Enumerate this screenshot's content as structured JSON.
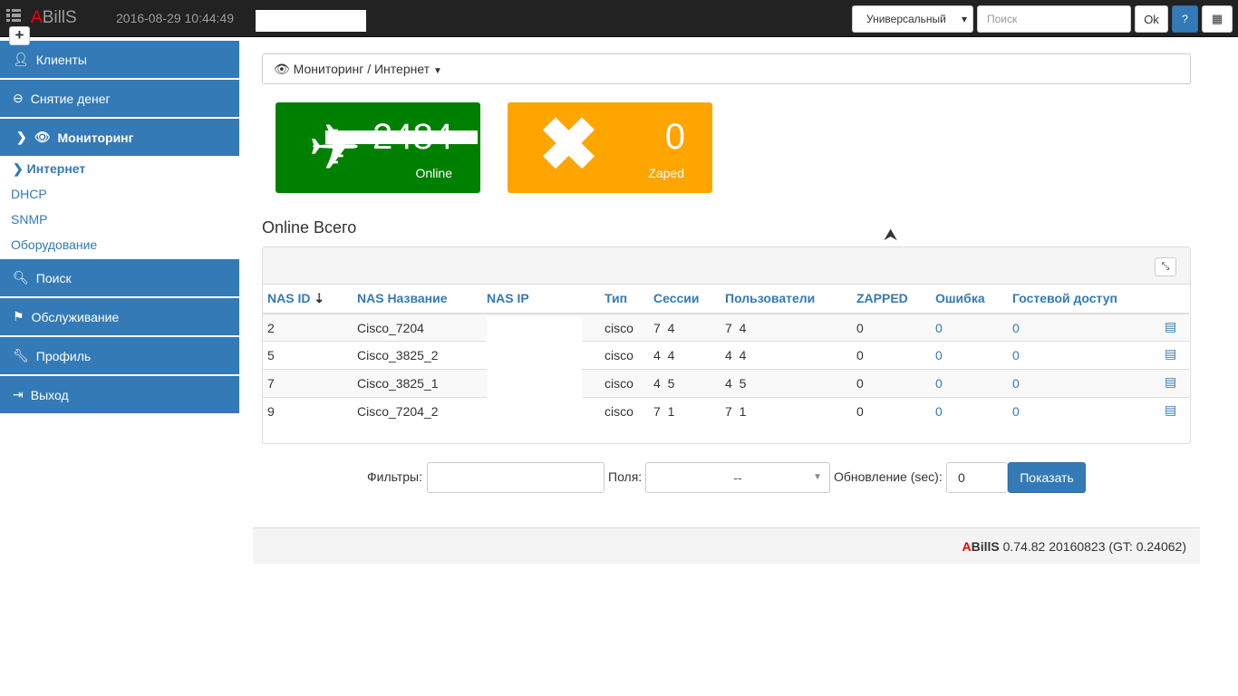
{
  "header": {
    "logo_a": "A",
    "logo_rest": "BillS",
    "datetime": "2016-08-29 10:44:49",
    "search_type": "Универсальный",
    "search_placeholder": "Поиск",
    "ok": "Ok",
    "help": "?"
  },
  "sidebar": {
    "items": [
      {
        "label": "Клиенты",
        "icon": "user-icon"
      },
      {
        "label": "Снятие денег",
        "icon": "minus-circle-icon"
      },
      {
        "label": "Мониторинг",
        "icon": "eye-icon"
      },
      {
        "label": "Поиск",
        "icon": "search-icon"
      },
      {
        "label": "Обслуживание",
        "icon": "flag-icon"
      },
      {
        "label": "Профиль",
        "icon": "wrench-icon"
      },
      {
        "label": "Выход",
        "icon": "logout-icon"
      }
    ],
    "submenu": [
      "Интернет",
      "DHCP",
      "SNMP",
      "Оборудование"
    ]
  },
  "breadcrumb": "Мониторинг / Интернет",
  "tiles": {
    "online_value": "2484",
    "online_label": "Online",
    "zaped_value": "0",
    "zaped_label": "Zaped",
    "online_color": "#008000",
    "zaped_color": "#ffa500"
  },
  "table": {
    "title": "Online Всего",
    "headers": [
      "NAS ID",
      "NAS Название",
      "NAS IP",
      "Тип",
      "Сессии",
      "Пользователи",
      "ZAPPED",
      "Ошибка",
      "Гостевой доступ"
    ],
    "rows": [
      {
        "id": "2",
        "name": "Cisco_7204",
        "type": "cisco",
        "sessions": "7  4",
        "users": "7  4",
        "zapped": "0",
        "error": "0",
        "guest": "0"
      },
      {
        "id": "5",
        "name": "Cisco_3825_2",
        "type": "cisco",
        "sessions": "4  4",
        "users": "4  4",
        "zapped": "0",
        "error": "0",
        "guest": "0"
      },
      {
        "id": "7",
        "name": "Cisco_3825_1",
        "type": "cisco",
        "sessions": "4  5",
        "users": "4  5",
        "zapped": "0",
        "error": "0",
        "guest": "0"
      },
      {
        "id": "9",
        "name": "Cisco_7204_2",
        "type": "cisco",
        "sessions": "7  1",
        "users": "7  1",
        "zapped": "0",
        "error": "0",
        "guest": "0"
      }
    ]
  },
  "filters": {
    "filter_label": "Фильтры:",
    "fields_label": "Поля:",
    "fields_value": "--",
    "refresh_label": "Обновление (sec):",
    "refresh_value": "0",
    "show": "Показать"
  },
  "footer": {
    "a": "A",
    "brand": "BillS",
    "version": "0.74.82 20160823 (GT: 0.24062)"
  }
}
